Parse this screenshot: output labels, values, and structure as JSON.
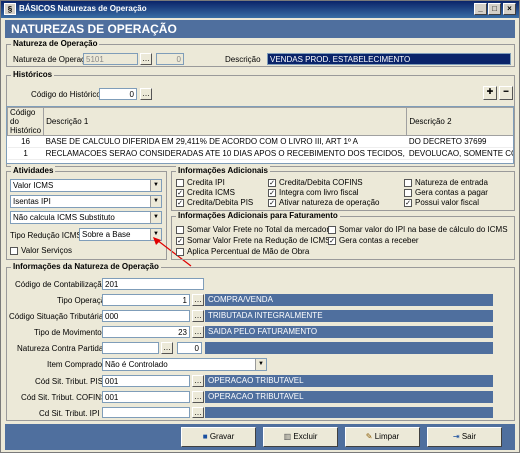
{
  "window": {
    "title": "BÁSICOS Naturezas de Operação",
    "minimize": "_",
    "maximize": "□",
    "close": "×"
  },
  "header": {
    "title": "NATUREZAS DE OPERAÇÃO"
  },
  "natureza": {
    "group_title": "Natureza de Operação",
    "label": "Natureza de Operação",
    "code": "5101",
    "seq": "0",
    "descricao_label": "Descrição",
    "descricao": "VENDAS PROD. ESTABELECIMENTO"
  },
  "historicos": {
    "group_title": "Históricos",
    "codigo_label": "Código do Histórico",
    "codigo_value": "0",
    "columns": [
      "Código do Histórico",
      "Descrição 1",
      "Descrição 2"
    ],
    "rows": [
      {
        "codigo": "16",
        "desc1": "BASE DE CALCULO DIFERIDA EM 29,411% DE ACORDO COM O LIVRO III, ART 1º A",
        "desc2": "DO DECRETO 37699"
      },
      {
        "codigo": "1",
        "desc1": "RECLAMACOES SERAO CONSIDERADAS ATE 10 DIAS APOS O RECEBIMENTO DOS TECIDOS,",
        "desc2": "DEVOLUCAO, SOMENTE COM"
      }
    ]
  },
  "atividades": {
    "group_title": "Atividades",
    "combo1": "Valor ICMS",
    "combo2": "Isentas IPI",
    "combo3": "Não calcula ICMS Substituto",
    "tipo_reducao_label": "Tipo Redução ICMS",
    "tipo_reducao": "Sobre a Base",
    "valor_servicos": "Valor Serviços"
  },
  "info_adicionais": {
    "group_title": "Informações Adicionais",
    "items": [
      {
        "label": "Credita IPI",
        "checked": false
      },
      {
        "label": "Credita/Debita COFINS",
        "checked": true
      },
      {
        "label": "Natureza de entrada",
        "checked": false
      },
      {
        "label": "Credita ICMS",
        "checked": true
      },
      {
        "label": "Integra com livro fiscal",
        "checked": true
      },
      {
        "label": "Gera contas a pagar",
        "checked": false
      },
      {
        "label": "Credita/Debita PIS",
        "checked": true
      },
      {
        "label": "Ativar natureza de operação",
        "checked": true
      },
      {
        "label": "Possui valor fiscal",
        "checked": true
      }
    ]
  },
  "info_faturamento": {
    "group_title": "Informações Adicionais para Faturamento",
    "items": [
      {
        "label": "Somar Valor Frete no Total da mercadoria",
        "checked": false
      },
      {
        "label": "Somar valor do IPI na base de cálculo do ICMS",
        "checked": false
      },
      {
        "label": "Somar Valor Frete na Redução de ICMS",
        "checked": true
      },
      {
        "label": "Gera contas a receber",
        "checked": true
      },
      {
        "label": "Aplica Percentual de Mão de Obra",
        "checked": false
      }
    ]
  },
  "info_natureza": {
    "group_title": "Informações da Natureza de Operação",
    "contabilizacao_label": "Código de Contabilização",
    "contabilizacao": "201",
    "tipo_operacao_label": "Tipo Operação",
    "tipo_operacao": "1",
    "tipo_operacao_desc": "COMPRA/VENDA",
    "cst_label": "Código Situação Tributária",
    "cst": "000",
    "cst_desc": "TRIBUTADA INTEGRALMENTE",
    "tipo_mov_label": "Tipo de Movimento",
    "tipo_mov": "23",
    "tipo_mov_desc": "SAIDA PELO FATURAMENTO",
    "contra_partida_label": "Natureza Contra Partida",
    "contra_partida_seq": "0",
    "item_comprado_label": "Item Comprado",
    "item_comprado": "Não é Controlado",
    "pis_label": "Cód Sit. Tribut. PIS",
    "pis": "001",
    "pis_desc": "OPERACAO TRIBUTAVEL",
    "cofins_label": "Cód Sit. Tribut. COFINS",
    "cofins": "001",
    "cofins_desc": "OPERACAO TRIBUTAVEL",
    "ipi_label": "Cd Sit. Tribut. IPI"
  },
  "actions": {
    "gravar": "Gravar",
    "excluir": "Excluir",
    "limpar": "Limpar",
    "sair": "Sair"
  }
}
